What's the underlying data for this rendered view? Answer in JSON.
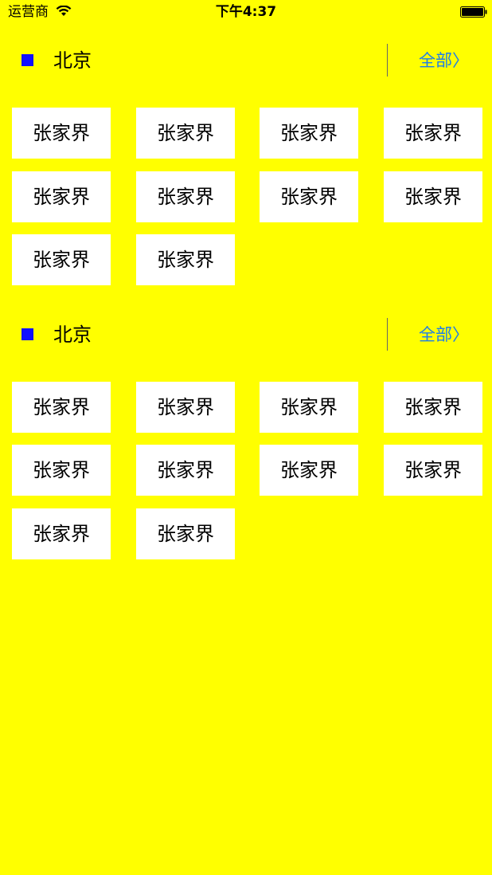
{
  "status_bar": {
    "carrier": "运营商",
    "time": "下午4:37"
  },
  "sections": [
    {
      "title": "北京",
      "all_label": "全部〉",
      "tags": [
        "张家界",
        "张家界",
        "张家界",
        "张家界",
        "张家界",
        "张家界",
        "张家界",
        "张家界",
        "张家界",
        "张家界"
      ]
    },
    {
      "title": "北京",
      "all_label": "全部〉",
      "tags": [
        "张家界",
        "张家界",
        "张家界",
        "张家界",
        "张家界",
        "张家界",
        "张家界",
        "张家界",
        "张家界",
        "张家界"
      ]
    }
  ],
  "colors": {
    "background": "#FFFF00",
    "bullet": "#1010FF",
    "link": "#1E7DE8",
    "tag_background": "#FFFFFF"
  }
}
